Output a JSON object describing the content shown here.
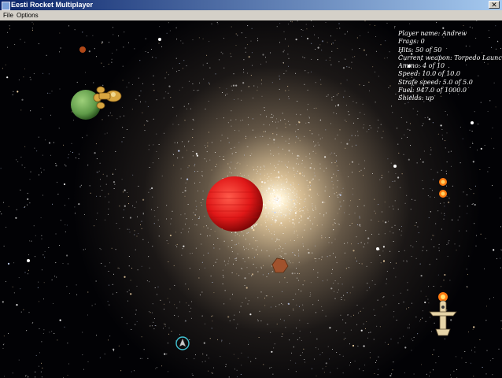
{
  "window": {
    "title": "Eesti Rocket Multiplayer",
    "close_glyph": "✕"
  },
  "menu": {
    "items": [
      "File",
      "Options"
    ]
  },
  "hud": {
    "player_name": "Player name: Andrew",
    "frags": "Frags: 0",
    "hits": "Hits: 50 of 50",
    "weapon": "Current weapon: Torpedo Launcher",
    "ammo": "Ammo: 4 of 10",
    "speed": "Speed: 10.0 of 10.0",
    "strafe_speed": "Strafe speed: 5.0 of 5.0",
    "fuel": "Fuel: 947.0 of 1000.0",
    "shields": "Shields: up"
  },
  "colors": {
    "red_planet": "#e01818",
    "green_planet": "#5e9a48",
    "star_core": "#fff4d8",
    "asteroid": "#a0522d"
  },
  "icons": [
    "red-planet",
    "green-planet",
    "golden-ship",
    "rocket-ship",
    "player-reticle",
    "asteroid",
    "fireball"
  ]
}
